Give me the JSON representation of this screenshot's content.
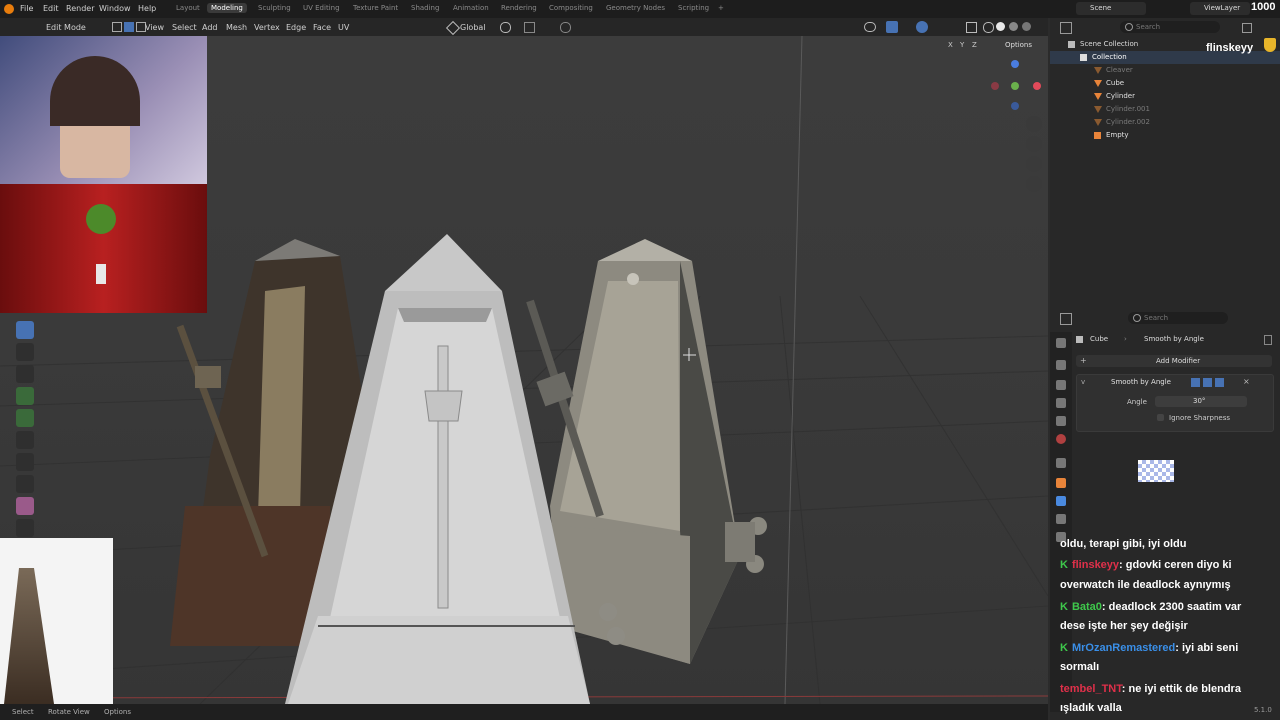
{
  "top_menu": {
    "items": [
      "File",
      "Edit",
      "Render",
      "Window",
      "Help"
    ],
    "workspaces": [
      "Layout",
      "Modeling",
      "Sculpting",
      "UV Editing",
      "Texture Paint",
      "Shading",
      "Animation",
      "Rendering",
      "Compositing",
      "Geometry Nodes",
      "Scripting"
    ],
    "active_workspace": "Modeling",
    "scene": "Scene",
    "view_layer": "ViewLayer"
  },
  "viewport_header": {
    "mode": "Edit Mode",
    "menus": [
      "View",
      "Select",
      "Add",
      "Mesh",
      "Vertex",
      "Edge",
      "Face",
      "UV"
    ],
    "transform": "Global",
    "options": "Options",
    "axes": [
      "X",
      "Y",
      "Z"
    ]
  },
  "outliner": {
    "search_placeholder": "Search",
    "scene_collection": "Scene Collection",
    "collection": "Collection",
    "objects": [
      {
        "name": "Cleaver",
        "dim": true
      },
      {
        "name": "Cube",
        "dim": false
      },
      {
        "name": "Cylinder",
        "dim": false
      },
      {
        "name": "Cylinder.001",
        "dim": true
      },
      {
        "name": "Cylinder.002",
        "dim": true
      },
      {
        "name": "Empty",
        "dim": false
      }
    ]
  },
  "properties": {
    "search_placeholder": "Search",
    "breadcrumb_object": "Cube",
    "breadcrumb_modifier": "Smooth by Angle",
    "add_modifier": "Add Modifier",
    "modifier_name": "Smooth by Angle",
    "angle_label": "Angle",
    "angle_value": "30°",
    "ignore_sharpness": "Ignore Sharpness"
  },
  "stream": {
    "channel": "flinskeyy",
    "counter": "1000",
    "version": "5.1.0"
  },
  "chat": [
    {
      "user": "",
      "message": "oldu, terapi gibi, iyi oldu",
      "user_color": "#ffffff",
      "badge": false
    },
    {
      "user": "flinskeyy",
      "message": ": gdovki ceren diyo ki",
      "user_color": "#e0304a",
      "badge": true
    },
    {
      "user": "",
      "message": "overwatch ile deadlock aynıymış",
      "user_color": "#ffffff",
      "badge": false
    },
    {
      "user": "Bata0",
      "message": ": deadlock 2300 saatim var",
      "user_color": "#3ec84b",
      "badge": true
    },
    {
      "user": "",
      "message": "dese işte her şey değişir",
      "user_color": "#ffffff",
      "badge": false
    },
    {
      "user": "MrOzanRemastered",
      "message": ": iyi abi seni",
      "user_color": "#3a8fe8",
      "badge": true
    },
    {
      "user": "",
      "message": "sormalı",
      "user_color": "#ffffff",
      "badge": false
    },
    {
      "user": "tembel_TNT",
      "message": ": ne iyi ettik de blendra",
      "user_color": "#e0304a",
      "badge": false
    },
    {
      "user": "",
      "message": "ışladık valla",
      "user_color": "#ffffff",
      "badge": false
    }
  ],
  "status_bar": {
    "items": [
      "Select",
      "Rotate View",
      "Options"
    ]
  },
  "colors": {
    "accent": "#4772b3",
    "object_orange": "#e8843a",
    "mesh_green": "#6ab04c"
  }
}
